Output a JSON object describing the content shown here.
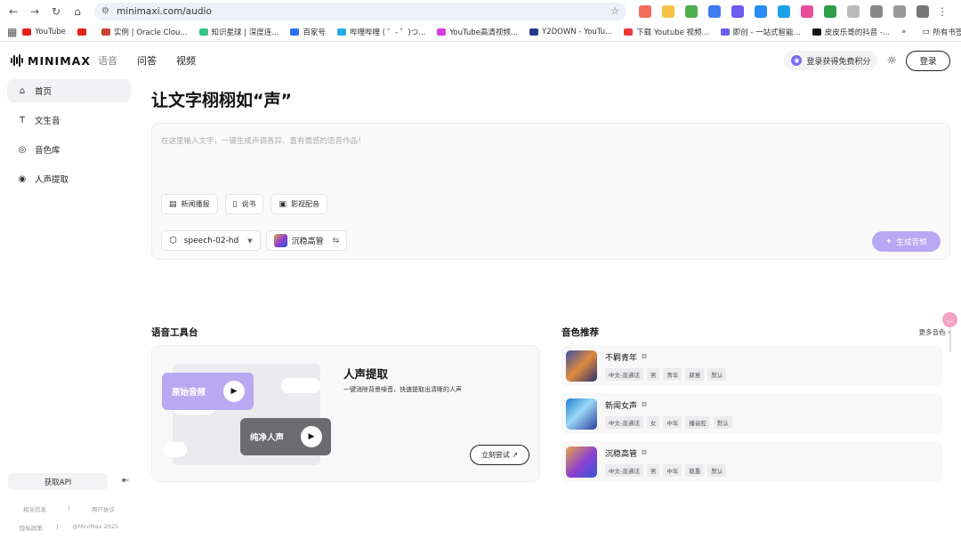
{
  "browser": {
    "url": "minimaxi.com/audio",
    "bookmarks": [
      {
        "label": "YouTube",
        "color": "#e62117"
      },
      {
        "label": "",
        "color": "#e62117"
      },
      {
        "label": "实例 | Oracle Clou...",
        "color": "#c74634"
      },
      {
        "label": "知识星球 | 深度连...",
        "color": "#3ac28b"
      },
      {
        "label": "百家号",
        "color": "#2f6ef6"
      },
      {
        "label": "哔哩哔哩 ( ゜- ゜)つ...",
        "color": "#23ade5"
      },
      {
        "label": "YouTube高清视频...",
        "color": "#d93ae0"
      },
      {
        "label": "Y2DOWN - YouTu...",
        "color": "#2a3b8f"
      },
      {
        "label": "下载 Youtube 视频...",
        "color": "#e83a3a"
      },
      {
        "label": "即创 - 一站式智能...",
        "color": "#6a5cf0"
      },
      {
        "label": "皮皮乐哥的抖音 -...",
        "color": "#111111"
      }
    ],
    "bookmarks_more": "»",
    "all_bookmarks": "所有书签"
  },
  "header": {
    "logo": "MINIMAX",
    "nav": [
      "语音",
      "问答",
      "视频"
    ],
    "promo": "登录获得免费积分",
    "login": "登录"
  },
  "sidebar": {
    "items": [
      {
        "label": "首页",
        "icon": "⌂"
      },
      {
        "label": "文生音",
        "icon": "T"
      },
      {
        "label": "音色库",
        "icon": "◎"
      },
      {
        "label": "人声提取",
        "icon": "◉"
      }
    ],
    "api_button": "获取API",
    "footer": {
      "row1": [
        "相关信息",
        "|",
        "用户协议"
      ],
      "row2": [
        "隐私政策",
        "|",
        "@MiniMax 2025"
      ]
    }
  },
  "main": {
    "headline": "让文字栩栩如“声”",
    "placeholder": "在这里输入文字，一键生成声调各异、富有情感的语音作品！",
    "chips": [
      "新闻播报",
      "说书",
      "影视配音"
    ],
    "model": "speech-02-hd",
    "voice": "沉稳高管",
    "generate": "生成音频"
  },
  "tools": {
    "section_title": "语音工具台",
    "original_label": "原始音频",
    "pure_label": "纯净人声",
    "title": "人声提取",
    "desc": "一键消除背景噪音，快速提取出清晰的人声",
    "try_button": "立刻尝试 ↗"
  },
  "voices": {
    "section_title": "音色推荐",
    "more": "更多音色 ›",
    "items": [
      {
        "name": "不羁青年",
        "tags": [
          "中文-普通话",
          "男",
          "青年",
          "肆意",
          "默认"
        ]
      },
      {
        "name": "新闻女声",
        "tags": [
          "中文-普通话",
          "女",
          "中年",
          "播音腔",
          "默认"
        ]
      },
      {
        "name": "沉稳高管",
        "tags": [
          "中文-普通话",
          "男",
          "中年",
          "稳重",
          "默认"
        ]
      }
    ]
  },
  "colors": {
    "accent": "#b8a8f4",
    "original_card": "#b8a9f2",
    "pure_card": "#6b6b70"
  }
}
